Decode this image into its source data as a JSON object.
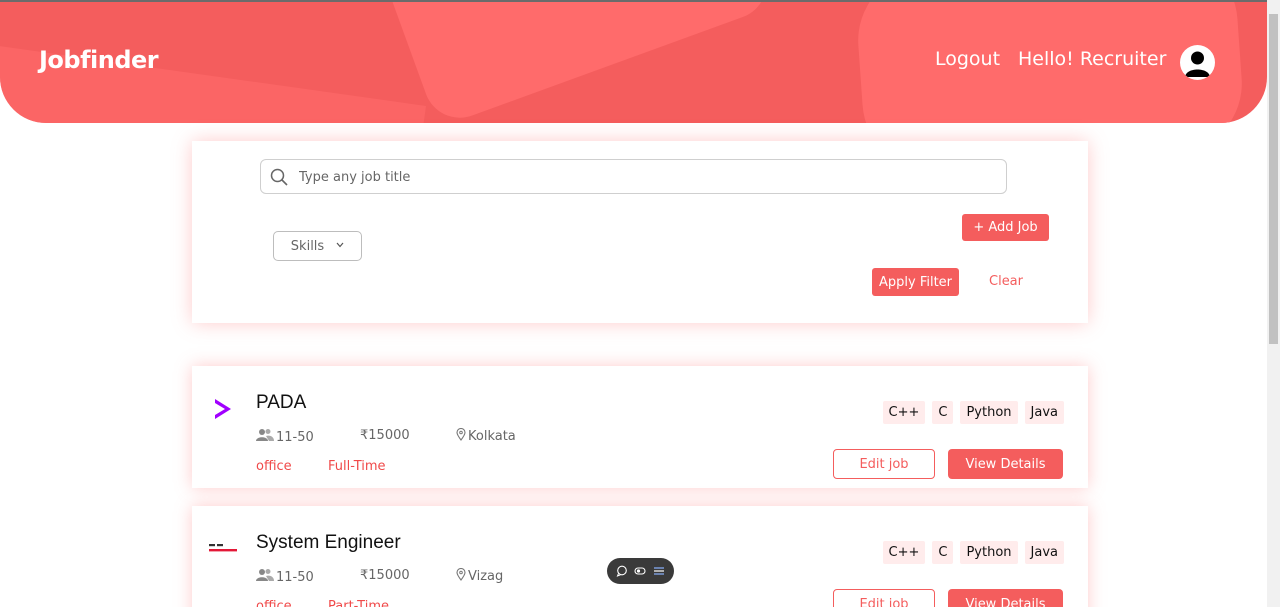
{
  "header": {
    "brand": "Jobfinder",
    "logout_label": "Logout",
    "greeting": "Hello! Recruiter",
    "avatar_icon": "user-avatar-icon"
  },
  "filters": {
    "search_placeholder": "Type any job title",
    "search_value": "",
    "skills_label": "Skills",
    "add_job_label": "+ Add Job",
    "apply_label": "Apply Filter",
    "clear_label": "Clear"
  },
  "jobs": [
    {
      "title": "PADA",
      "logo": "accenture-chevron-logo",
      "size": "11-50",
      "salary": "₹15000",
      "location": "Kolkata",
      "work_mode": "office",
      "job_type": "Full-Time",
      "skills": [
        "C++",
        "C",
        "Python",
        "Java"
      ],
      "edit_label": "Edit job",
      "view_label": "View Details"
    },
    {
      "title": "System Engineer",
      "logo": "tech-mahindra-logo",
      "size": "11-50",
      "salary": "₹15000",
      "location": "Vizag",
      "work_mode": "office",
      "job_type": "Part-Time",
      "skills": [
        "C++",
        "C",
        "Python",
        "Java"
      ],
      "edit_label": "Edit job",
      "view_label": "View Details"
    }
  ],
  "colors": {
    "primary": "#f45d5d",
    "accent_light": "#ffecec",
    "logo_purple": "#a100ff"
  }
}
